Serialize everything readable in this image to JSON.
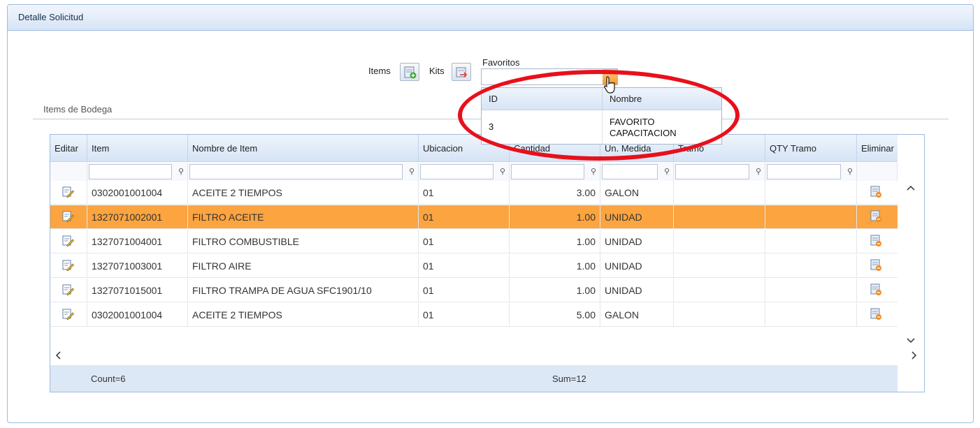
{
  "panel": {
    "title": "Detalle Solicitud"
  },
  "toolbar": {
    "items_label": "Items",
    "kits_label": "Kits",
    "favoritos_label": "Favoritos"
  },
  "dropdown": {
    "col_id": "ID",
    "col_nombre": "Nombre",
    "rows": [
      {
        "id": "3",
        "nombre_line1": "FAVORITO",
        "nombre_line2": "CAPACITACION"
      }
    ]
  },
  "fieldset": {
    "legend": "Items de Bodega"
  },
  "grid": {
    "columns": [
      "Editar",
      "Item",
      "Nombre de Item",
      "Ubicacion",
      "Cantidad",
      "Un. Medida",
      "Tramo",
      "QTY Tramo",
      "Eliminar"
    ],
    "rows": [
      {
        "item": "0302001001004",
        "nombre": "ACEITE 2 TIEMPOS",
        "ubicacion": "01",
        "cantidad": "3.00",
        "unidad": "GALON",
        "selected": false
      },
      {
        "item": "1327071002001",
        "nombre": "FILTRO ACEITE",
        "ubicacion": "01",
        "cantidad": "1.00",
        "unidad": "UNIDAD",
        "selected": true
      },
      {
        "item": "1327071004001",
        "nombre": "FILTRO COMBUSTIBLE",
        "ubicacion": "01",
        "cantidad": "1.00",
        "unidad": "UNIDAD",
        "selected": false
      },
      {
        "item": "1327071003001",
        "nombre": "FILTRO AIRE",
        "ubicacion": "01",
        "cantidad": "1.00",
        "unidad": "UNIDAD",
        "selected": false
      },
      {
        "item": "1327071015001",
        "nombre": "FILTRO TRAMPA DE AGUA SFC1901/10",
        "ubicacion": "01",
        "cantidad": "1.00",
        "unidad": "UNIDAD",
        "selected": false
      },
      {
        "item": "0302001001004",
        "nombre": "ACEITE 2 TIEMPOS",
        "ubicacion": "01",
        "cantidad": "5.00",
        "unidad": "GALON",
        "selected": false
      }
    ],
    "footer": {
      "count": "Count=6",
      "sum": "Sum=12"
    }
  },
  "colors": {
    "selected_row": "#fba440",
    "header_blue": "#d6e4f6",
    "highlight_ellipse": "#e8101b"
  }
}
